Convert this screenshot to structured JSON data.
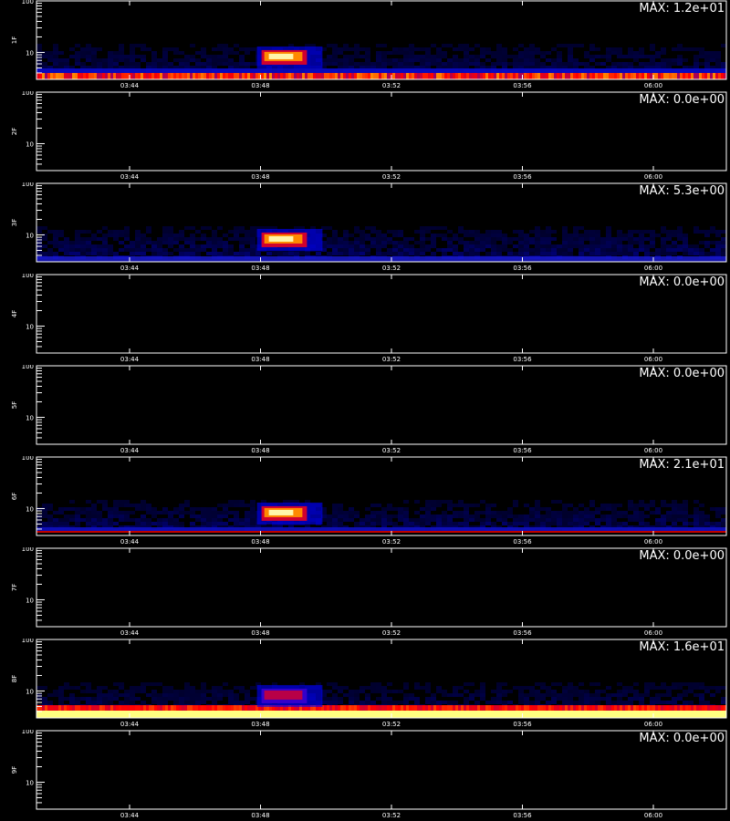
{
  "chart_data": [
    {
      "type": "heatmap",
      "ylabel": "1F",
      "max_label": "MAX: 1.2e+01",
      "max_value": 12,
      "yscale": "log",
      "ylim": [
        3,
        100
      ],
      "yticklabels": [
        "100",
        "10"
      ],
      "xticklabels": [
        "03:44",
        "03:48",
        "03:52",
        "03:56",
        "06:00"
      ],
      "blob": {
        "start": "03:47",
        "end": "03:49",
        "level": "high"
      },
      "floor": {
        "style": "warm-band",
        "level": 0.55
      },
      "noise": 0.35
    },
    {
      "type": "heatmap",
      "ylabel": "2F",
      "max_label": "MAX: 0.0e+00",
      "max_value": 0,
      "yscale": "log",
      "ylim": [
        3,
        100
      ],
      "yticklabels": [
        "100",
        "10"
      ],
      "xticklabels": [
        "03:44",
        "03:48",
        "03:52",
        "03:56",
        "06:00"
      ],
      "blob": null,
      "floor": null,
      "noise": 0
    },
    {
      "type": "heatmap",
      "ylabel": "3F",
      "max_label": "MAX: 5.3e+00",
      "max_value": 5.3,
      "yscale": "log",
      "ylim": [
        3,
        100
      ],
      "yticklabels": [
        "100",
        "10"
      ],
      "xticklabels": [
        "03:44",
        "03:48",
        "03:52",
        "03:56",
        "06:00"
      ],
      "blob": {
        "start": "03:47",
        "end": "03:49",
        "level": "high"
      },
      "floor": {
        "style": "blue",
        "level": 0.3
      },
      "noise": 0.4
    },
    {
      "type": "heatmap",
      "ylabel": "4F",
      "max_label": "MAX: 0.0e+00",
      "max_value": 0,
      "yscale": "log",
      "ylim": [
        3,
        100
      ],
      "yticklabels": [
        "100",
        "10"
      ],
      "xticklabels": [
        "03:44",
        "03:48",
        "03:52",
        "03:56",
        "06:00"
      ],
      "blob": null,
      "floor": null,
      "noise": 0
    },
    {
      "type": "heatmap",
      "ylabel": "5F",
      "max_label": "MAX: 0.0e+00",
      "max_value": 0,
      "yscale": "log",
      "ylim": [
        3,
        100
      ],
      "yticklabels": [
        "100",
        "10"
      ],
      "xticklabels": [
        "03:44",
        "03:48",
        "03:52",
        "03:56",
        "06:00"
      ],
      "blob": null,
      "floor": null,
      "noise": 0
    },
    {
      "type": "heatmap",
      "ylabel": "6F",
      "max_label": "MAX: 2.1e+01",
      "max_value": 21,
      "yscale": "log",
      "ylim": [
        3,
        100
      ],
      "yticklabels": [
        "100",
        "10"
      ],
      "xticklabels": [
        "03:44",
        "03:48",
        "03:52",
        "03:56",
        "06:00"
      ],
      "blob": {
        "start": "03:47",
        "end": "03:49",
        "level": "high"
      },
      "floor": {
        "style": "red-line",
        "level": 0.5
      },
      "noise": 0.4
    },
    {
      "type": "heatmap",
      "ylabel": "7F",
      "max_label": "MAX: 0.0e+00",
      "max_value": 0,
      "yscale": "log",
      "ylim": [
        3,
        100
      ],
      "yticklabels": [
        "100",
        "10"
      ],
      "xticklabels": [
        "03:44",
        "03:48",
        "03:52",
        "03:56",
        "06:00"
      ],
      "blob": null,
      "floor": null,
      "noise": 0
    },
    {
      "type": "heatmap",
      "ylabel": "8F",
      "max_label": "MAX: 1.6e+01",
      "max_value": 16,
      "yscale": "log",
      "ylim": [
        3,
        100
      ],
      "yticklabels": [
        "100",
        "10"
      ],
      "xticklabels": [
        "03:44",
        "03:48",
        "03:52",
        "03:56",
        "06:00"
      ],
      "blob": {
        "start": "03:47",
        "end": "03:49",
        "level": "medium"
      },
      "floor": {
        "style": "hot-band",
        "level": 0.9
      },
      "noise": 0.35
    },
    {
      "type": "heatmap",
      "ylabel": "9F",
      "max_label": "MAX: 0.0e+00",
      "max_value": 0,
      "yscale": "log",
      "ylim": [
        3,
        100
      ],
      "yticklabels": [
        "100",
        "10"
      ],
      "xticklabels": [
        "03:44",
        "03:48",
        "03:52",
        "03:56",
        "06:00"
      ],
      "blob": null,
      "floor": null,
      "noise": 0
    }
  ],
  "colors": {
    "background": "#000000",
    "axes": "#ffffff",
    "low": "#0000ff",
    "mid": "#ff0000",
    "high": "#ffff00",
    "peak": "#ffffff"
  }
}
